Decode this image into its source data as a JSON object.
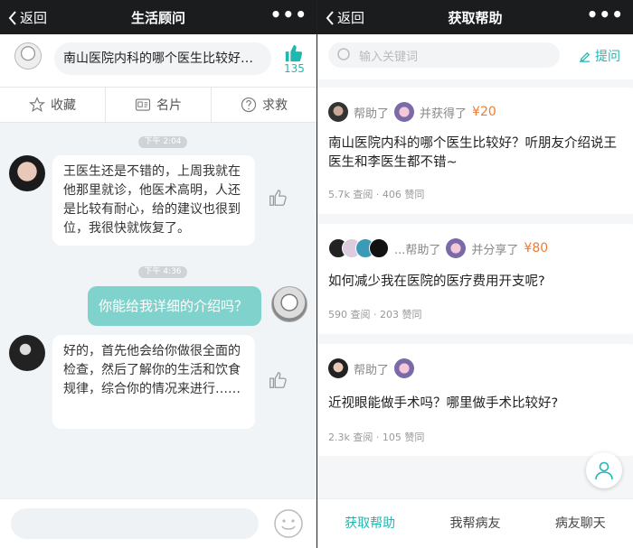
{
  "left": {
    "nav": {
      "back_label": "返回",
      "title": "生活顾问",
      "more": "•••"
    },
    "question": {
      "text": "南山医院内科的哪个医生比较好…",
      "likes": "135"
    },
    "actions": [
      {
        "label": "收藏",
        "icon": "star-icon"
      },
      {
        "label": "名片",
        "icon": "card-icon"
      },
      {
        "label": "求救",
        "icon": "help-icon"
      }
    ],
    "chat": {
      "time1": "下午 2:04",
      "msg1": "王医生还是不错的，上周我就在他那里就诊，他医术高明，人还是比较有耐心，给的建议也很到位，我很快就恢复了。",
      "time2": "下午 4:36",
      "msg2": "你能给我详细的介绍吗？",
      "msg3": "好的，首先他会给你做很全面的检查，然后了解你的生活和饮食规律，综合你的情况来进行……"
    }
  },
  "right": {
    "nav": {
      "back_label": "返回",
      "title": "获取帮助",
      "more": "•••"
    },
    "search": {
      "placeholder": "输入关键词"
    },
    "ask_label": "提问",
    "cards": [
      {
        "helped": "帮助了",
        "gain": "并获得了",
        "reward": "¥20",
        "title": "南山医院内科的哪个医生比较好？听朋友介绍说王医生和李医生都不错~",
        "views": "5.7k 查阅",
        "likes": "406 赞同"
      },
      {
        "helped": "...帮助了",
        "gain": "并分享了",
        "reward": "¥80",
        "title": "如何减少我在医院的医疗费用开支呢?",
        "views": "590 查阅",
        "likes": "203 赞同"
      },
      {
        "helped": "帮助了",
        "gain": "",
        "reward": "",
        "title": "近视眼能做手术吗？哪里做手术比较好?",
        "views": "2.3k 查阅",
        "likes": "105 赞同"
      }
    ],
    "tabs": [
      "获取帮助",
      "我帮病友",
      "病友聊天"
    ]
  },
  "colors": {
    "accent": "#1fb8b1",
    "reward": "#f07b32",
    "navbar": "#1b1c1e"
  }
}
